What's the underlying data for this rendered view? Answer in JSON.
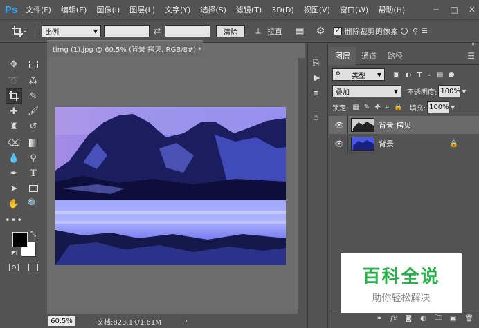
{
  "app": {
    "logo": "Ps"
  },
  "menu": [
    "文件(F)",
    "编辑(E)",
    "图像(I)",
    "图层(L)",
    "文字(Y)",
    "选择(S)",
    "滤镜(T)",
    "3D(D)",
    "视图(V)",
    "窗口(W)",
    "帮助(H)"
  ],
  "window_controls": {
    "minimize": "─",
    "maximize": "□",
    "close": "✕"
  },
  "options": {
    "ratio_select": "比例",
    "clear_label": "清除",
    "straighten_label": "拉直",
    "delete_cropped_label": "删除裁剪的像素",
    "delete_cropped_checked": true
  },
  "document": {
    "tab_title": "timg (1).jpg @ 60.5% (背景 拷贝, RGB/8#) *",
    "zoom": "60.5%",
    "doc_size": "文档:823.1K/1.61M"
  },
  "layers_panel": {
    "tabs": [
      "图层",
      "通道",
      "路径"
    ],
    "filter_kind": "类型",
    "blend_mode": "叠加",
    "opacity_label": "不透明度:",
    "opacity_value": "100%",
    "lock_label": "锁定:",
    "fill_label": "填充:",
    "fill_value": "100%",
    "layers": [
      {
        "name": "背景 拷贝",
        "selected": true,
        "locked": false
      },
      {
        "name": "背景",
        "selected": false,
        "locked": true
      }
    ]
  },
  "watermark": {
    "title": "百科全说",
    "subtitle": "助你轻松解决",
    "color": "#2ab04a"
  }
}
